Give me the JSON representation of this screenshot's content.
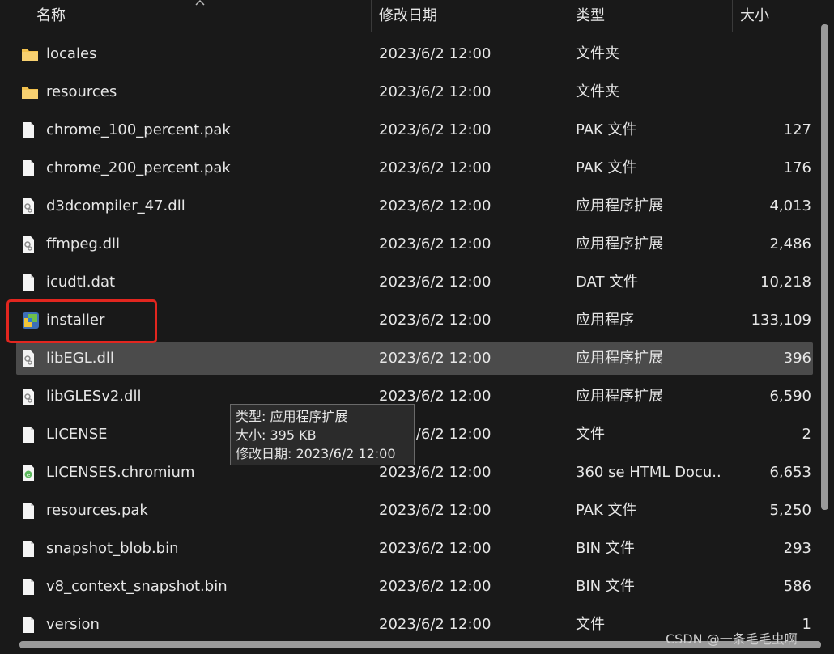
{
  "columns": {
    "name": "名称",
    "date": "修改日期",
    "type": "类型",
    "size": "大小"
  },
  "rows": [
    {
      "icon": "folder-icon",
      "name": "locales",
      "date": "2023/6/2 12:00",
      "type": "文件夹",
      "size": ""
    },
    {
      "icon": "folder-icon",
      "name": "resources",
      "date": "2023/6/2 12:00",
      "type": "文件夹",
      "size": ""
    },
    {
      "icon": "file-icon",
      "name": "chrome_100_percent.pak",
      "date": "2023/6/2 12:00",
      "type": "PAK 文件",
      "size": "127"
    },
    {
      "icon": "file-icon",
      "name": "chrome_200_percent.pak",
      "date": "2023/6/2 12:00",
      "type": "PAK 文件",
      "size": "176"
    },
    {
      "icon": "dll-file-icon",
      "name": "d3dcompiler_47.dll",
      "date": "2023/6/2 12:00",
      "type": "应用程序扩展",
      "size": "4,013"
    },
    {
      "icon": "dll-file-icon",
      "name": "ffmpeg.dll",
      "date": "2023/6/2 12:00",
      "type": "应用程序扩展",
      "size": "2,486"
    },
    {
      "icon": "file-icon",
      "name": "icudtl.dat",
      "date": "2023/6/2 12:00",
      "type": "DAT 文件",
      "size": "10,218"
    },
    {
      "icon": "installer-app-icon",
      "name": "installer",
      "date": "2023/6/2 12:00",
      "type": "应用程序",
      "size": "133,109"
    },
    {
      "icon": "dll-file-icon",
      "name": "libEGL.dll",
      "date": "2023/6/2 12:00",
      "type": "应用程序扩展",
      "size": "396"
    },
    {
      "icon": "dll-file-icon",
      "name": "libGLESv2.dll",
      "date": "2023/6/2 12:00",
      "type": "应用程序扩展",
      "size": "6,590"
    },
    {
      "icon": "file-icon",
      "name": "LICENSE",
      "date": "2023/6/2 12:00",
      "type": "文件",
      "size": "2"
    },
    {
      "icon": "html-file-icon",
      "name": "LICENSES.chromium",
      "date": "2023/6/2 12:00",
      "type": "360 se HTML Docu...",
      "size": "6,653"
    },
    {
      "icon": "file-icon",
      "name": "resources.pak",
      "date": "2023/6/2 12:00",
      "type": "PAK 文件",
      "size": "5,250"
    },
    {
      "icon": "file-icon",
      "name": "snapshot_blob.bin",
      "date": "2023/6/2 12:00",
      "type": "BIN 文件",
      "size": "293"
    },
    {
      "icon": "file-icon",
      "name": "v8_context_snapshot.bin",
      "date": "2023/6/2 12:00",
      "type": "BIN 文件",
      "size": "586"
    },
    {
      "icon": "file-icon",
      "name": "version",
      "date": "2023/6/2 12:00",
      "type": "文件",
      "size": "1"
    }
  ],
  "tooltip": {
    "line1": "类型: 应用程序扩展",
    "line2": "大小: 395 KB",
    "line3": "修改日期: 2023/6/2 12:00"
  },
  "watermark": "CSDN @一条毛毛虫啊",
  "colors": {
    "highlight": "#e2261f",
    "hover_row": "#4b4b4b",
    "background": "#191919",
    "folder": "#f2c14e"
  }
}
